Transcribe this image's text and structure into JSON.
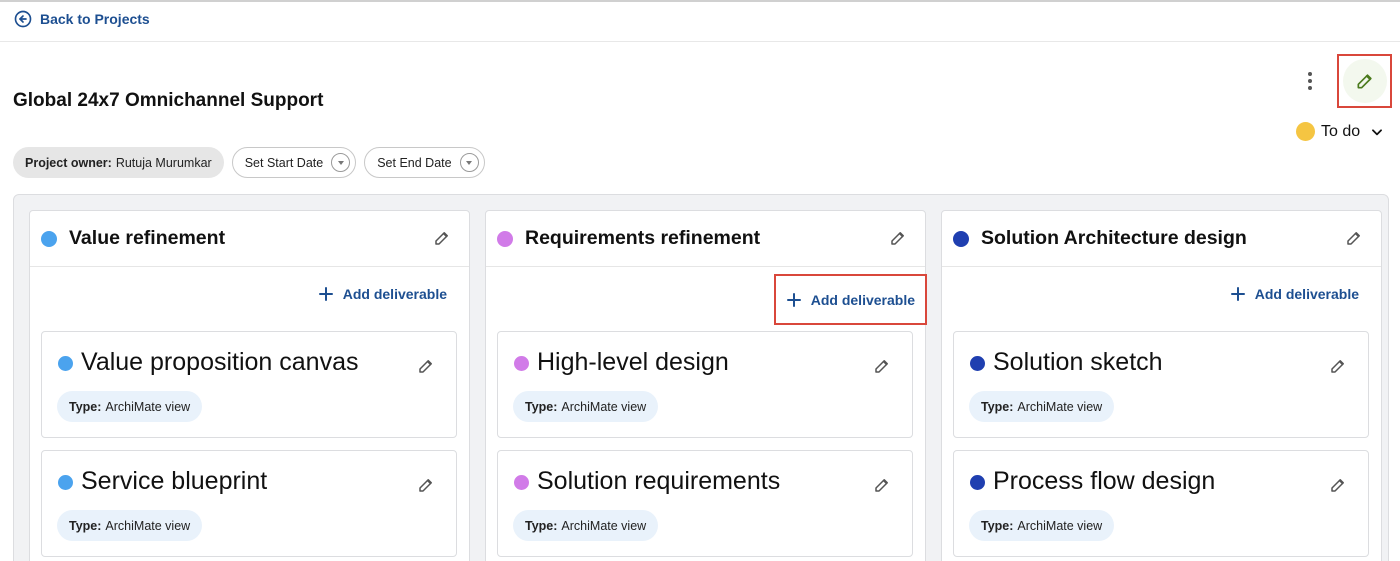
{
  "nav": {
    "back_label": "Back to Projects"
  },
  "project": {
    "title": "Global 24x7 Omnichannel Support",
    "status": {
      "label": "To do",
      "color": "#f5c542"
    },
    "owner": {
      "label": "Project owner:",
      "value": "Rutuja Murumkar"
    },
    "start_date_label": "Set Start Date",
    "end_date_label": "Set End Date"
  },
  "columns": [
    {
      "title": "Value refinement",
      "color": "#4ba3ee",
      "add_label": "Add deliverable",
      "cards": [
        {
          "title": "Value proposition canvas",
          "type_label": "Type:",
          "type_value": "ArchiMate view"
        },
        {
          "title": "Service blueprint",
          "type_label": "Type:",
          "type_value": "ArchiMate view"
        }
      ]
    },
    {
      "title": "Requirements refinement",
      "color": "#d17be8",
      "add_label": "Add deliverable",
      "cards": [
        {
          "title": "High-level design",
          "type_label": "Type:",
          "type_value": "ArchiMate view"
        },
        {
          "title": "Solution requirements",
          "type_label": "Type:",
          "type_value": "ArchiMate view"
        }
      ]
    },
    {
      "title": "Solution Architecture design",
      "color": "#1f3fb0",
      "add_label": "Add deliverable",
      "cards": [
        {
          "title": "Solution sketch",
          "type_label": "Type:",
          "type_value": "ArchiMate view"
        },
        {
          "title": "Process flow design",
          "type_label": "Type:",
          "type_value": "ArchiMate view"
        }
      ]
    }
  ],
  "colors": {
    "link": "#1d4f91",
    "highlight": "#d9473b",
    "edit_icon": "#4a7a1c"
  }
}
